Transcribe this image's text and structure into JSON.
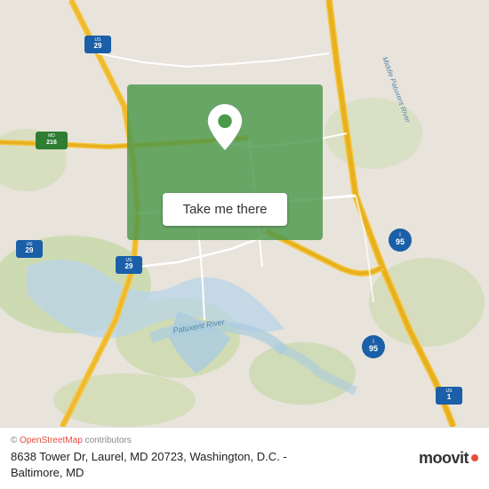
{
  "map": {
    "alt": "Map of 8638 Tower Dr, Laurel MD 20723",
    "overlay": {
      "button_label": "Take me there"
    }
  },
  "footer": {
    "copyright": "© OpenStreetMap contributors",
    "address_line1": "8638 Tower Dr, Laurel, MD 20723, Washington, D.C. -",
    "address_line2": "Baltimore, MD",
    "logo_text": "moovit"
  },
  "roads": {
    "accent_color": "#f0c040",
    "highway_color": "#f5a623",
    "minor_road_color": "#ffffff",
    "green_area": "#c8d8b0",
    "water_color": "#aad0e8"
  }
}
